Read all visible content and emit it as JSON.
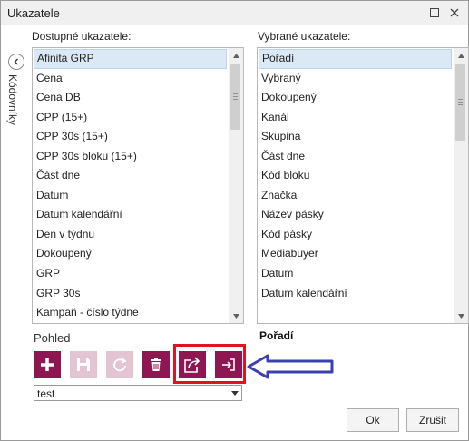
{
  "window": {
    "title": "Ukazatele"
  },
  "sidebar": {
    "tab_label": "Kódovníky"
  },
  "available": {
    "label": "Dostupné ukazatele:",
    "items": [
      "Afinita GRP",
      "Cena",
      "Cena DB",
      "CPP (15+)",
      "CPP 30s (15+)",
      "CPP 30s bloku (15+)",
      "Část dne",
      "Datum",
      "Datum kalendářní",
      "Den v týdnu",
      "Dokoupený",
      "GRP",
      "GRP 30s",
      "Kampaň - číslo týdne"
    ],
    "selected_index": 0
  },
  "chosen": {
    "label": "Vybrané ukazatele:",
    "items": [
      "Pořadí",
      "Vybraný",
      "Dokoupený",
      "Kanál",
      "Skupina",
      "Část dne",
      "Kód bloku",
      "Značka",
      "Název pásky",
      "Kód pásky",
      "Mediabuyer",
      "Datum",
      "Datum kalendářní"
    ],
    "selected_index": 0
  },
  "view": {
    "label": "Pohled",
    "selected_value": "test",
    "current_item_label": "Pořadí"
  },
  "toolbar": {
    "buttons": [
      {
        "icon": "plus-icon",
        "enabled": true
      },
      {
        "icon": "save-icon",
        "enabled": false
      },
      {
        "icon": "refresh-icon",
        "enabled": false
      },
      {
        "icon": "delete-icon",
        "enabled": true
      },
      {
        "icon": "export-icon",
        "enabled": true
      },
      {
        "icon": "import-icon",
        "enabled": true
      }
    ]
  },
  "annotation": {
    "box_color": "#e0141e",
    "arrow_color": "#3a40b0"
  },
  "colors": {
    "accent": "#8e1752",
    "accent_disabled": "#e2c4d2",
    "selection": "#dbe9f7"
  },
  "buttons": {
    "ok": "Ok",
    "cancel": "Zrušit"
  }
}
